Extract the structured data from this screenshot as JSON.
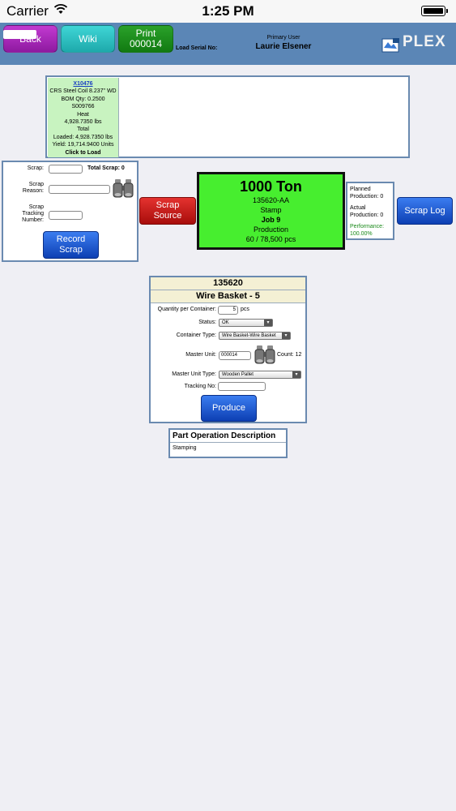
{
  "status_bar": {
    "carrier": "Carrier",
    "time": "1:25 PM"
  },
  "header": {
    "back_label": "Back",
    "wiki_label": "Wiki",
    "print_label_line1": "Print",
    "print_label_line2": "000014",
    "load_serial_label": "Load Serial No:",
    "primary_user_label": "Primary User",
    "primary_user_name": "Laurie Elsener",
    "logo_text": "PLEX"
  },
  "load": {
    "link": "X10476",
    "lines": [
      "CRS Steel Coil 8.237\" WD",
      "BOM Qty: 0.2500",
      "S009766",
      "Heat",
      "4,928.7350 lbs",
      "Total",
      "Loaded: 4,928.7350 lbs",
      "Yield: 19,714.9400 Units"
    ],
    "click": "Click to Load"
  },
  "scrap": {
    "scrap_label": "Scrap:",
    "total_scrap": "Total Scrap: 0",
    "reason_label_1": "Scrap",
    "reason_label_2": "Reason:",
    "tracking_label_1": "Scrap",
    "tracking_label_2": "Tracking",
    "tracking_label_3": "Number:",
    "record_line1": "Record",
    "record_line2": "Scrap",
    "source_line1": "Scrap",
    "source_line2": "Source"
  },
  "machine": {
    "name": "1000 Ton",
    "part": "135620-AA",
    "operation": "Stamp",
    "job": "Job 9",
    "status": "Production",
    "count": "60 / 78,500 pcs"
  },
  "production": {
    "planned_1": "Planned",
    "planned_2": "Production: 0",
    "actual_1": "Actual",
    "actual_2": "Production: 0",
    "performance_1": "Performance:",
    "performance_2": "100.00%"
  },
  "scrap_log_label": "Scrap Log",
  "part": {
    "number": "135620",
    "name": "Wire Basket - 5",
    "qty_label": "Quantity per Container:",
    "qty_value": "5",
    "qty_unit": "pcs",
    "status_label": "Status:",
    "status_value": "OK",
    "container_type_label": "Container Type:",
    "container_type_value": "Wire Basket-Wire Basket",
    "master_unit_label": "Master Unit:",
    "master_unit_value": "000014",
    "count_text": "Count: 12",
    "master_unit_type_label": "Master Unit Type:",
    "master_unit_type_value": "Wooden Pallet",
    "tracking_label": "Tracking No:",
    "produce_label": "Produce"
  },
  "part_operation": {
    "title": "Part Operation Description",
    "value": "Stamping"
  },
  "colors": {
    "header_bg": "#5b86b6",
    "machine_bg": "#47ee2f",
    "load_bg": "#c8f3c0"
  }
}
